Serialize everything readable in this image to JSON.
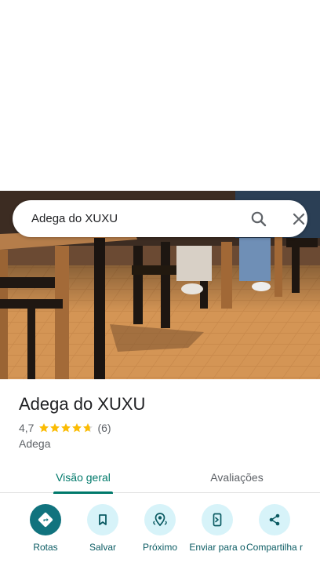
{
  "search": {
    "query": "Adega do XUXU"
  },
  "place": {
    "name": "Adega do XUXU",
    "rating": "4,7",
    "stars": 4.7,
    "review_count": "(6)",
    "category": "Adega"
  },
  "tabs": [
    {
      "label": "Visão geral",
      "selected": true
    },
    {
      "label": "Avaliações",
      "selected": false
    }
  ],
  "actions": [
    {
      "label": "Rotas",
      "icon": "directions-icon"
    },
    {
      "label": "Salvar",
      "icon": "bookmark-icon"
    },
    {
      "label": "Próximo",
      "icon": "nearby-icon"
    },
    {
      "label": "Enviar para o",
      "icon": "send-to-phone-icon"
    },
    {
      "label": "Compartilha r",
      "icon": "share-icon"
    }
  ],
  "colors": {
    "accent": "#00796b",
    "action_primary": "#11737e",
    "action_bg": "#d7f3f9",
    "star": "#fbbc04"
  }
}
